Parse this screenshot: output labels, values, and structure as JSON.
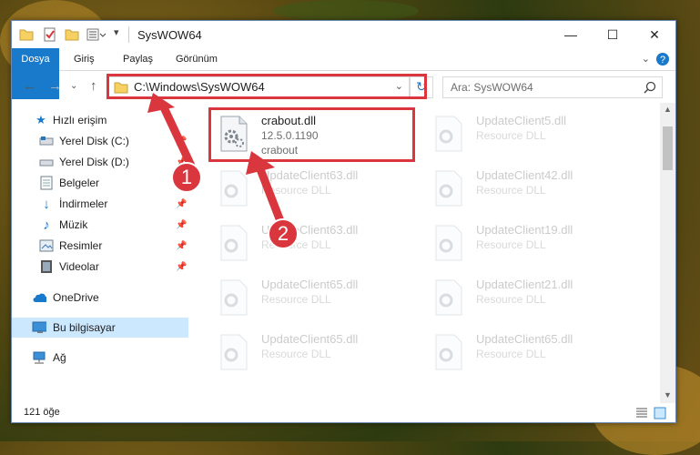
{
  "window": {
    "title": "SysWOW64",
    "controls": {
      "minimize": "—",
      "maximize": "☐",
      "close": "✕"
    }
  },
  "ribbon": {
    "tabs": [
      {
        "label": "Dosya"
      },
      {
        "label": "Giriş"
      },
      {
        "label": "Paylaş"
      },
      {
        "label": "Görünüm"
      }
    ]
  },
  "navbar": {
    "address": "C:\\Windows\\SysWOW64",
    "search_placeholder": "Ara: SysWOW64"
  },
  "sidebar": {
    "items": [
      {
        "label": "Hızlı erişim"
      },
      {
        "label": "Yerel Disk (C:)"
      },
      {
        "label": "Yerel Disk (D:)"
      },
      {
        "label": "Belgeler"
      },
      {
        "label": "İndirmeler"
      },
      {
        "label": "Müzik"
      },
      {
        "label": "Resimler"
      },
      {
        "label": "Videolar"
      },
      {
        "label": "OneDrive"
      },
      {
        "label": "Bu bilgisayar"
      },
      {
        "label": "Ağ"
      }
    ]
  },
  "files": [
    {
      "name": "crabout.dll",
      "sub1": "12.5.0.1190",
      "sub2": "crabout"
    },
    {
      "name": "UpdateClient5.dll",
      "sub1": "Resource DLL"
    },
    {
      "name": "UpdateClient63.dll",
      "sub1": "Resource DLL"
    },
    {
      "name": "UpdateClient42.dll",
      "sub1": "Resource DLL"
    },
    {
      "name": "UpdateClient63.dll",
      "sub1": "Resource DLL"
    },
    {
      "name": "UpdateClient19.dll",
      "sub1": "Resource DLL"
    },
    {
      "name": "UpdateClient65.dll",
      "sub1": "Resource DLL"
    },
    {
      "name": "UpdateClient21.dll",
      "sub1": "Resource DLL"
    },
    {
      "name": "UpdateClient65.dll",
      "sub1": "Resource DLL"
    },
    {
      "name": "UpdateClient65.dll",
      "sub1": "Resource DLL"
    }
  ],
  "status": {
    "count": "121 öğe"
  },
  "callouts": {
    "one": "1",
    "two": "2"
  },
  "colors": {
    "accent": "#1979ca",
    "highlight": "#d9363e",
    "selection": "#cce8ff"
  }
}
